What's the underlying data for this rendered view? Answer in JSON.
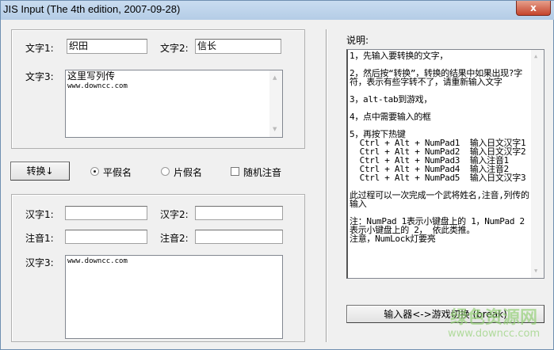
{
  "window": {
    "title": "JIS Input (The 4th edition, 2007-09-28)",
    "close_label": "x"
  },
  "top_group": {
    "text1_label": "文字1:",
    "text1_value": "织田",
    "text2_label": "文字2:",
    "text2_value": "信长",
    "text3_label": "文字3:",
    "text3_line1": "这里写列传",
    "text3_line2": "www.downcc.com"
  },
  "controls": {
    "convert_label": "转换↓",
    "hiragana_label": "平假名",
    "katakana_label": "片假名",
    "random_label": "随机注音",
    "selected": "hiragana",
    "random_checked": false
  },
  "bottom_group": {
    "kanji1_label": "汉字1:",
    "kanji1_value": "",
    "kanji2_label": "汉字2:",
    "kanji2_value": "",
    "note1_label": "注音1:",
    "note1_value": "",
    "note2_label": "注音2:",
    "note2_value": "",
    "kanji3_label": "汉字3:",
    "kanji3_value": "www.downcc.com"
  },
  "help": {
    "label": "说明:",
    "text": "1，先输入要转换的文字，\n\n2，然后按“转换”，转换的结果中如果出现?字符，表示有些字转不了，请重新输入文字\n\n3，alt-tab到游戏，\n\n4，点中需要输入的框\n\n5，再按下热键\n  Ctrl + Alt + NumPad1  输入日文汉字1\n  Ctrl + Alt + NumPad2  输入日文汉字2\n  Ctrl + Alt + NumPad3  输入注音1\n  Ctrl + Alt + NumPad4  输入注音2\n  Ctrl + Alt + NumPad5  输入日文汉字3\n\n此过程可以一次完成一个武将姓名,注音,列传的输入\n\n注：NumPad 1表示小键盘上的 1，NumPad 2表示小键盘上的 2， 依此类推。\n注意，NumLock灯要亮"
  },
  "switch_button": {
    "label": "输入器<->游戏切换 (break)"
  },
  "watermark": {
    "title": "绿色资源网",
    "url": "www.downcc.com"
  }
}
